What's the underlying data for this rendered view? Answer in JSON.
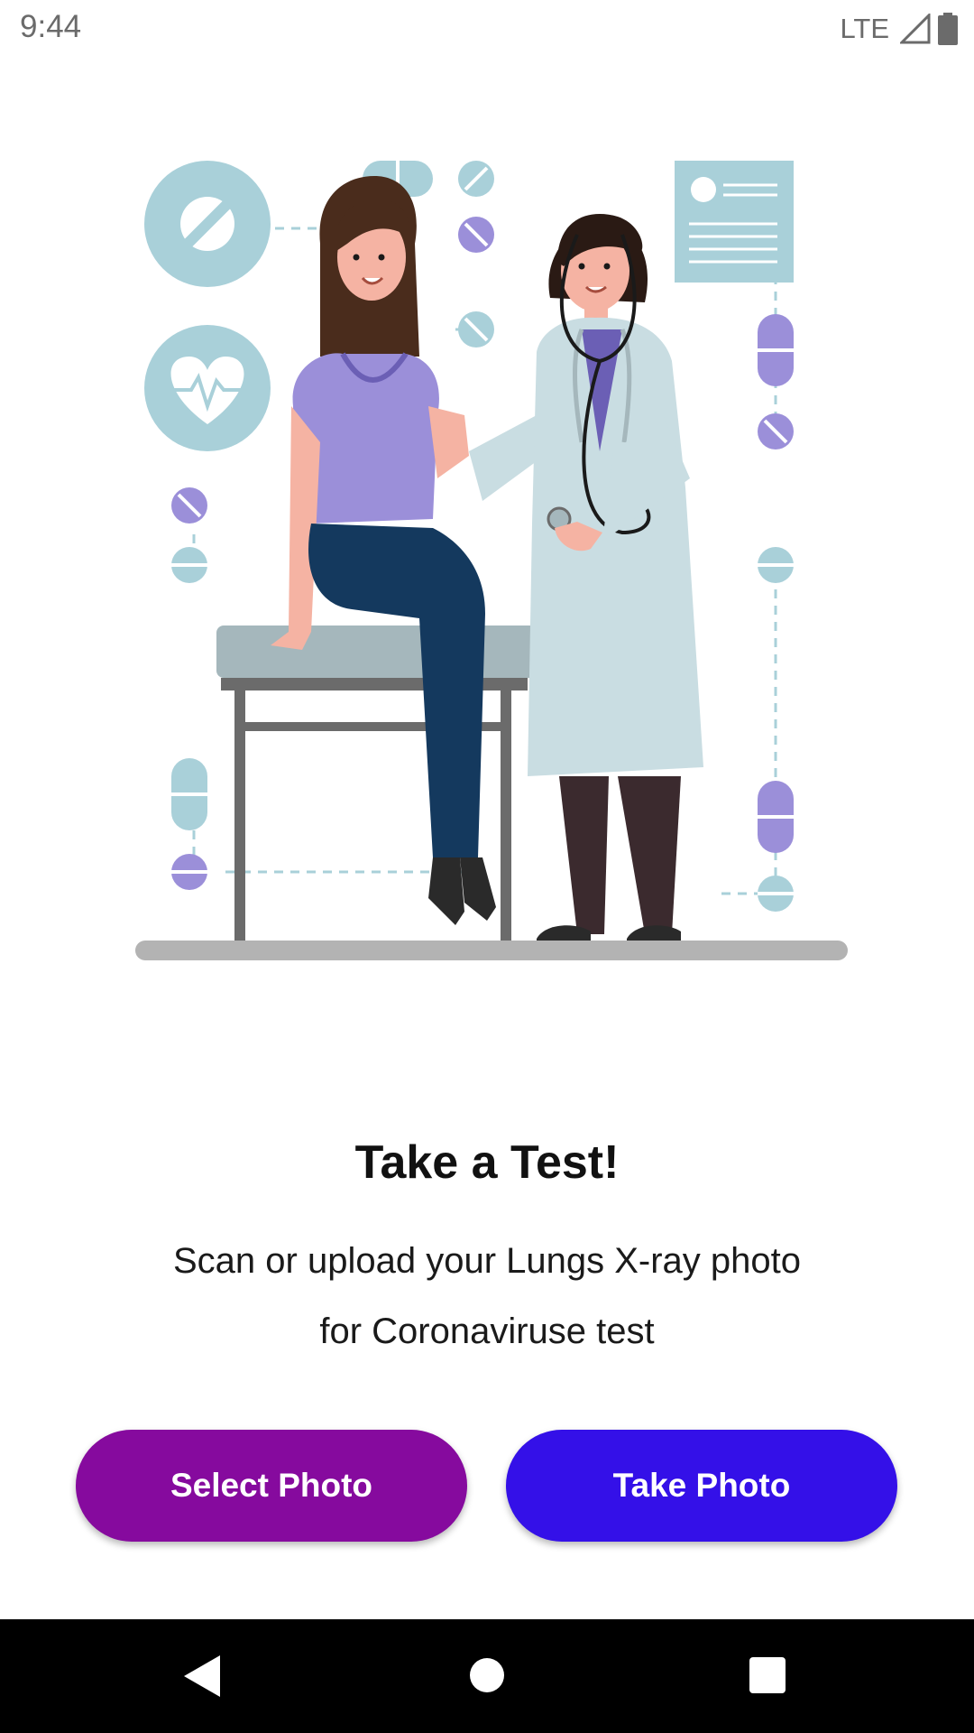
{
  "status_bar": {
    "time": "9:44",
    "network": "LTE",
    "icons": [
      "signal-icon",
      "battery-icon"
    ]
  },
  "illustration": {
    "subject": "doctor-examining-patient-illustration"
  },
  "main": {
    "title": "Take a Test!",
    "subtitle": "Scan or upload your Lungs X-ray photo for Coronaviruse test"
  },
  "buttons": {
    "select_photo": "Select Photo",
    "take_photo": "Take Photo"
  },
  "colors": {
    "select_button": "#860a9e",
    "take_button": "#3410e8",
    "accent_purple": "#9b8fd9",
    "accent_teal": "#a9d0d9"
  },
  "nav_bar": {
    "icons": [
      "back-icon",
      "home-icon",
      "recents-icon"
    ]
  }
}
